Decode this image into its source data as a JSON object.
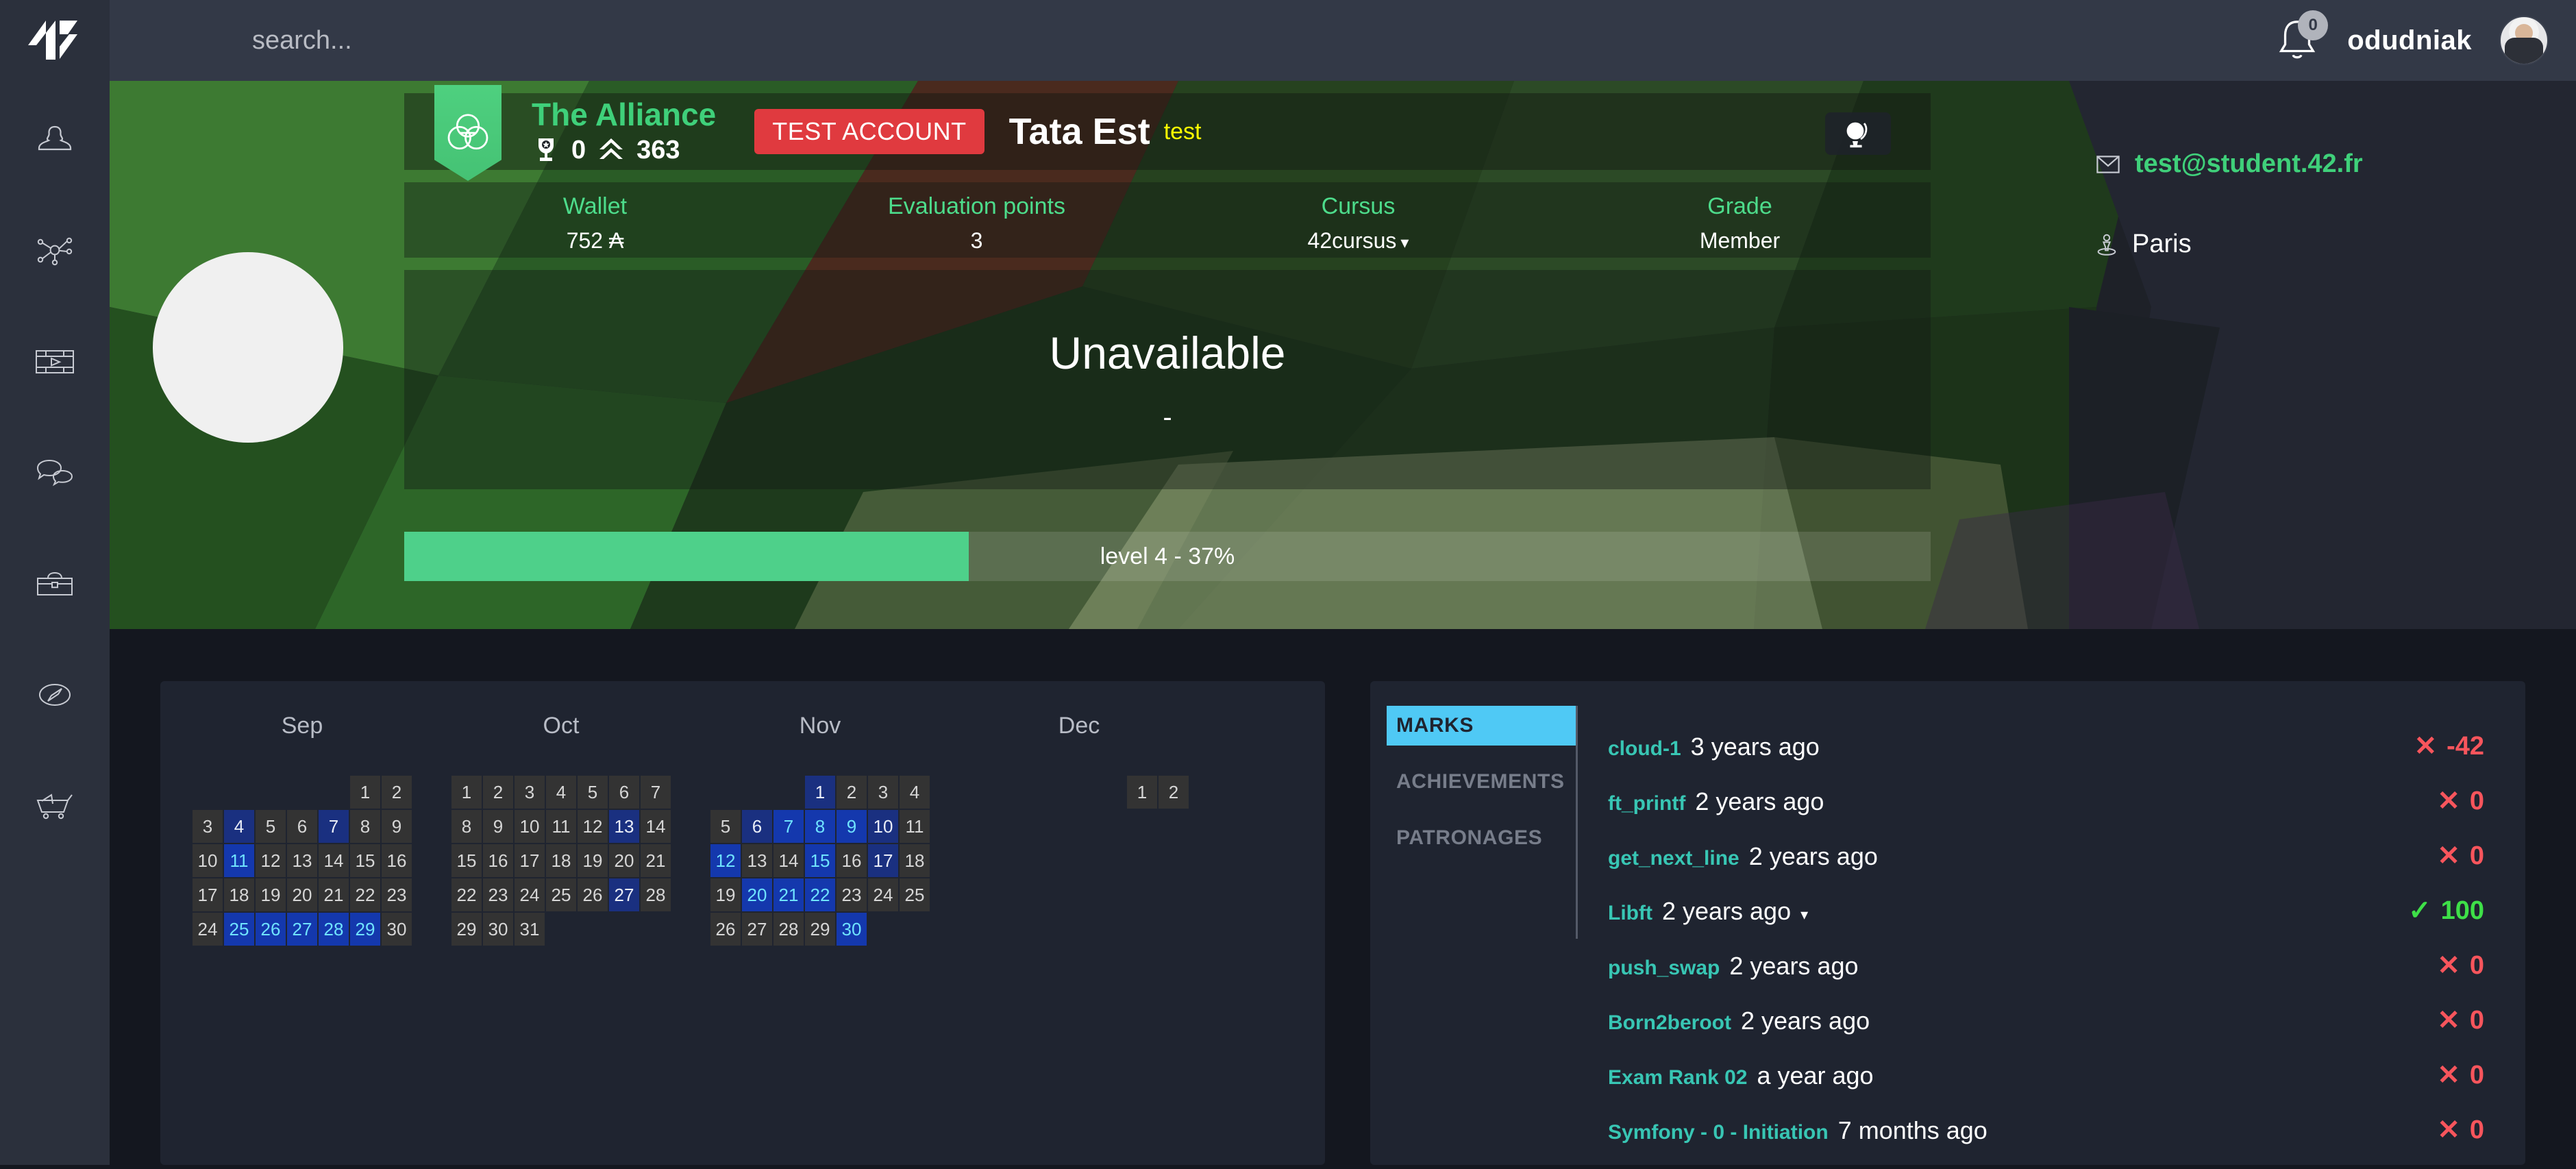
{
  "topbar": {
    "logo_alt": "42 logo",
    "search_placeholder": "search...",
    "notification_count": "0",
    "username": "odudniak"
  },
  "sidebar": {
    "items": [
      {
        "icon": "person-icon",
        "name": "profile"
      },
      {
        "icon": "network-icon",
        "name": "network"
      },
      {
        "icon": "media-icon",
        "name": "media"
      },
      {
        "icon": "chat-icon",
        "name": "chat"
      },
      {
        "icon": "toolbox-icon",
        "name": "toolbox"
      },
      {
        "icon": "compass-icon",
        "name": "compass"
      },
      {
        "icon": "cart-icon",
        "name": "shop"
      }
    ]
  },
  "banner": {
    "coalition_name": "The Alliance",
    "trophy_points": "0",
    "rank_points": "363",
    "test_badge": "TEST ACCOUNT",
    "display_name": "Tata Est",
    "login": "test",
    "globe_button": "globe-icon"
  },
  "stats": [
    {
      "label": "Wallet",
      "value": "752 ₳"
    },
    {
      "label": "Evaluation points",
      "value": "3"
    },
    {
      "label": "Cursus",
      "value": "42cursus"
    },
    {
      "label": "Grade",
      "value": "Member"
    }
  ],
  "level": {
    "title": "Unavailable",
    "subtitle": "-",
    "progress_label": "level 4 - 37%",
    "progress_percent": 37
  },
  "contact": {
    "email": "test@student.42.fr",
    "location": "Paris"
  },
  "calendar": {
    "months": [
      {
        "name": "Sep",
        "weeks": [
          [
            {
              "d": ""
            },
            {
              "d": ""
            },
            {
              "d": ""
            },
            {
              "d": ""
            },
            {
              "d": ""
            },
            {
              "d": "1",
              "l": 0
            },
            {
              "d": "2",
              "l": 0
            }
          ],
          [
            {
              "d": "3",
              "l": 0
            },
            {
              "d": "4",
              "l": 1
            },
            {
              "d": "5",
              "l": 0
            },
            {
              "d": "6",
              "l": 0
            },
            {
              "d": "7",
              "l": 1
            },
            {
              "d": "8",
              "l": 0
            },
            {
              "d": "9",
              "l": 0
            }
          ],
          [
            {
              "d": "10",
              "l": 0
            },
            {
              "d": "11",
              "l": 2
            },
            {
              "d": "12",
              "l": 0
            },
            {
              "d": "13",
              "l": 0
            },
            {
              "d": "14",
              "l": 0
            },
            {
              "d": "15",
              "l": 0
            },
            {
              "d": "16",
              "l": 0
            }
          ],
          [
            {
              "d": "17",
              "l": 0
            },
            {
              "d": "18",
              "l": 0
            },
            {
              "d": "19",
              "l": 0
            },
            {
              "d": "20",
              "l": 0
            },
            {
              "d": "21",
              "l": 0
            },
            {
              "d": "22",
              "l": 0
            },
            {
              "d": "23",
              "l": 0
            }
          ],
          [
            {
              "d": "24",
              "l": 0
            },
            {
              "d": "25",
              "l": 2
            },
            {
              "d": "26",
              "l": 2
            },
            {
              "d": "27",
              "l": 2
            },
            {
              "d": "28",
              "l": 2
            },
            {
              "d": "29",
              "l": 2
            },
            {
              "d": "30",
              "l": 0
            }
          ]
        ]
      },
      {
        "name": "Oct",
        "weeks": [
          [
            {
              "d": "1",
              "l": 0
            },
            {
              "d": "2",
              "l": 0
            },
            {
              "d": "3",
              "l": 0
            },
            {
              "d": "4",
              "l": 0
            },
            {
              "d": "5",
              "l": 0
            },
            {
              "d": "6",
              "l": 0
            },
            {
              "d": "7",
              "l": 0
            }
          ],
          [
            {
              "d": "8",
              "l": 0
            },
            {
              "d": "9",
              "l": 0
            },
            {
              "d": "10",
              "l": 0
            },
            {
              "d": "11",
              "l": 0
            },
            {
              "d": "12",
              "l": 0
            },
            {
              "d": "13",
              "l": 1
            },
            {
              "d": "14",
              "l": 0
            }
          ],
          [
            {
              "d": "15",
              "l": 0
            },
            {
              "d": "16",
              "l": 0
            },
            {
              "d": "17",
              "l": 0
            },
            {
              "d": "18",
              "l": 0
            },
            {
              "d": "19",
              "l": 0
            },
            {
              "d": "20",
              "l": 0
            },
            {
              "d": "21",
              "l": 0
            }
          ],
          [
            {
              "d": "22",
              "l": 0
            },
            {
              "d": "23",
              "l": 0
            },
            {
              "d": "24",
              "l": 0
            },
            {
              "d": "25",
              "l": 0
            },
            {
              "d": "26",
              "l": 0
            },
            {
              "d": "27",
              "l": 1
            },
            {
              "d": "28",
              "l": 0
            }
          ],
          [
            {
              "d": "29",
              "l": 0
            },
            {
              "d": "30",
              "l": 0
            },
            {
              "d": "31",
              "l": 0
            },
            {
              "d": ""
            },
            {
              "d": ""
            },
            {
              "d": ""
            },
            {
              "d": ""
            }
          ]
        ]
      },
      {
        "name": "Nov",
        "weeks": [
          [
            {
              "d": ""
            },
            {
              "d": ""
            },
            {
              "d": ""
            },
            {
              "d": "1",
              "l": 1
            },
            {
              "d": "2",
              "l": 0
            },
            {
              "d": "3",
              "l": 0
            },
            {
              "d": "4",
              "l": 0
            }
          ],
          [
            {
              "d": "5",
              "l": 0
            },
            {
              "d": "6",
              "l": 1
            },
            {
              "d": "7",
              "l": 2
            },
            {
              "d": "8",
              "l": 2
            },
            {
              "d": "9",
              "l": 2
            },
            {
              "d": "10",
              "l": 1
            },
            {
              "d": "11",
              "l": 0
            }
          ],
          [
            {
              "d": "12",
              "l": 2
            },
            {
              "d": "13",
              "l": 0
            },
            {
              "d": "14",
              "l": 0
            },
            {
              "d": "15",
              "l": 2
            },
            {
              "d": "16",
              "l": 0
            },
            {
              "d": "17",
              "l": 1
            },
            {
              "d": "18",
              "l": 0
            }
          ],
          [
            {
              "d": "19",
              "l": 0
            },
            {
              "d": "20",
              "l": 2
            },
            {
              "d": "21",
              "l": 2
            },
            {
              "d": "22",
              "l": 2
            },
            {
              "d": "23",
              "l": 0
            },
            {
              "d": "24",
              "l": 0
            },
            {
              "d": "25",
              "l": 0
            }
          ],
          [
            {
              "d": "26",
              "l": 0
            },
            {
              "d": "27",
              "l": 0
            },
            {
              "d": "28",
              "l": 0
            },
            {
              "d": "29",
              "l": 0
            },
            {
              "d": "30",
              "l": 2
            },
            {
              "d": ""
            },
            {
              "d": ""
            }
          ]
        ]
      },
      {
        "name": "Dec",
        "weeks": [
          [
            {
              "d": ""
            },
            {
              "d": ""
            },
            {
              "d": ""
            },
            {
              "d": ""
            },
            {
              "d": ""
            },
            {
              "d": "1",
              "l": 0
            },
            {
              "d": "2",
              "l": 0
            }
          ]
        ]
      }
    ]
  },
  "marks": {
    "tabs": [
      {
        "label": "MARKS",
        "active": true
      },
      {
        "label": "ACHIEVEMENTS",
        "active": false
      },
      {
        "label": "PATRONAGES",
        "active": false
      }
    ],
    "rows": [
      {
        "name": "cloud-1",
        "date": "3 years ago",
        "score": "-42",
        "status": "fail",
        "caret": false
      },
      {
        "name": "ft_printf",
        "date": "2 years ago",
        "score": "0",
        "status": "fail",
        "caret": false
      },
      {
        "name": "get_next_line",
        "date": "2 years ago",
        "score": "0",
        "status": "fail",
        "caret": false
      },
      {
        "name": "Libft",
        "date": "2 years ago",
        "score": "100",
        "status": "pass",
        "caret": true
      },
      {
        "name": "push_swap",
        "date": "2 years ago",
        "score": "0",
        "status": "fail",
        "caret": false
      },
      {
        "name": "Born2beroot",
        "date": "2 years ago",
        "score": "0",
        "status": "fail",
        "caret": false
      },
      {
        "name": "Exam Rank 02",
        "date": "a year ago",
        "score": "0",
        "status": "fail",
        "caret": false
      },
      {
        "name": "Symfony - 0 - Initiation",
        "date": "7 months ago",
        "score": "0",
        "status": "fail",
        "caret": false
      }
    ]
  },
  "colors": {
    "coalition_green": "#3fd07a",
    "accent_cyan": "#4fc9f5",
    "fail_red": "#f8555c",
    "pass_green": "#3ee048",
    "login_yellow": "#ffff00",
    "badge_red": "#e03a3f",
    "card_bg": "#1f2430",
    "page_bg": "#14171f",
    "topbar_bg": "#333947",
    "sidebar_bg": "#2b303c"
  }
}
